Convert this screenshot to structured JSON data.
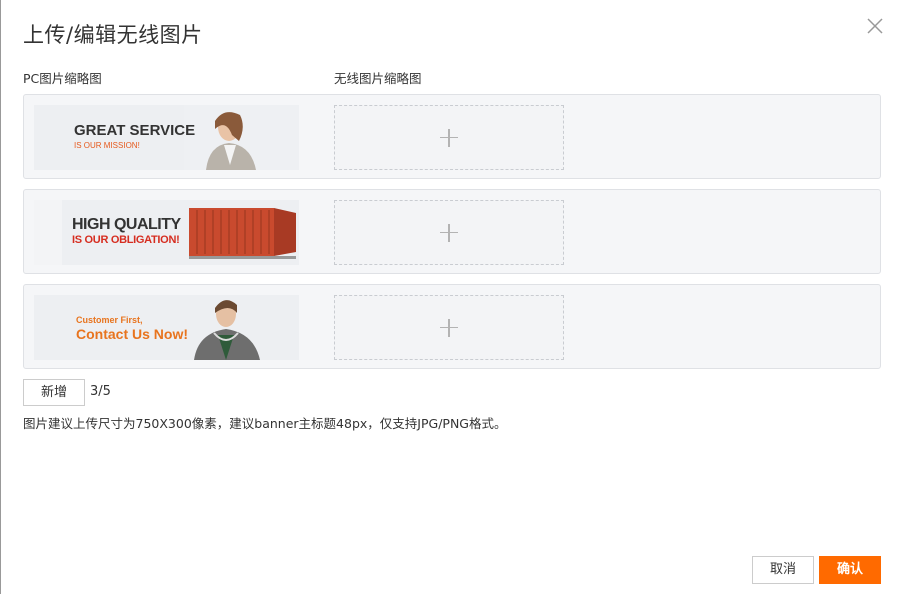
{
  "dialog": {
    "title": "上传/编辑无线图片",
    "close_icon": "close-icon"
  },
  "columns": {
    "pc_label": "PC图片缩略图",
    "mobile_label": "无线图片缩略图"
  },
  "rows": [
    {
      "pc_thumb": {
        "line1": "GREAT SERVICE",
        "line2": "IS OUR MISSION!",
        "image": "businesswoman-photo"
      },
      "mobile_upload_icon": "plus-icon"
    },
    {
      "pc_thumb": {
        "line1": "HIGH QUALITY",
        "line2": "IS OUR OBLIGATION!",
        "image": "shipping-container-photo"
      },
      "mobile_upload_icon": "plus-icon"
    },
    {
      "pc_thumb": {
        "line1": "Customer First,",
        "line2": "Contact Us Now!",
        "image": "shop-assistant-photo"
      },
      "mobile_upload_icon": "plus-icon"
    }
  ],
  "add_button_label": "新增",
  "count_text": "3/5",
  "hint": "图片建议上传尺寸为750X300像素，建议banner主标题48px，仅支持JPG/PNG格式。",
  "footer": {
    "cancel_label": "取消",
    "confirm_label": "确认"
  },
  "colors": {
    "accent": "#ff6a00"
  }
}
